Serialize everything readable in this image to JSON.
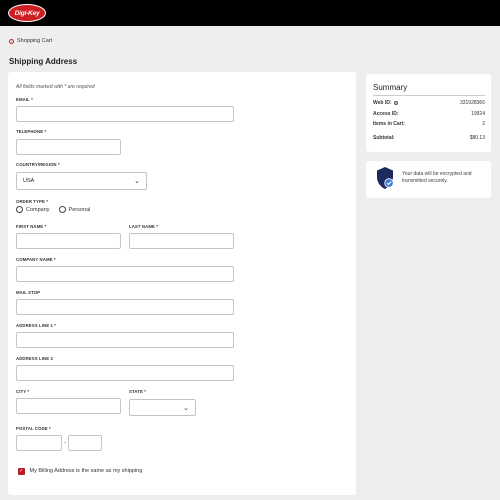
{
  "header": {
    "logo_text": "Digi-Key",
    "logo_color": "#cc1f24"
  },
  "breadcrumb": {
    "label": "Shopping Cart"
  },
  "page_title": "Shipping Address",
  "form": {
    "required_note": "All fields marked with * are required",
    "email_label": "EMAIL *",
    "telephone_label": "TELEPHONE *",
    "country_label": "COUNTRY/REGION *",
    "country_value": "USA",
    "order_type_label": "ORDER TYPE *",
    "order_type_options": [
      "Company",
      "Personal"
    ],
    "first_name_label": "FIRST NAME *",
    "last_name_label": "LAST NAME *",
    "company_label": "COMPANY NAME *",
    "mail_stop_label": "MAIL STOP",
    "address1_label": "ADDRESS LINE 1 *",
    "address2_label": "ADDRESS LINE 2",
    "city_label": "CITY *",
    "state_label": "STATE *",
    "state_value": "",
    "postal_label": "POSTAL CODE *",
    "postal_separator": "-",
    "billing_same_label": "My Billing Address is the same as my shipping",
    "billing_same_checked": true
  },
  "summary": {
    "title": "Summary",
    "web_id_label": "Web ID:",
    "web_id_value": "331928366",
    "access_id_label": "Access ID:",
    "access_id_value": "19924",
    "items_label": "Items in Cart:",
    "items_value": "2",
    "subtotal_label": "Subtotal:",
    "subtotal_value": "$80.13"
  },
  "security": {
    "message": "Your data will be encrypted and transmitted securely.",
    "icon": "shield-check-icon",
    "accent": "#1f2a5c"
  }
}
